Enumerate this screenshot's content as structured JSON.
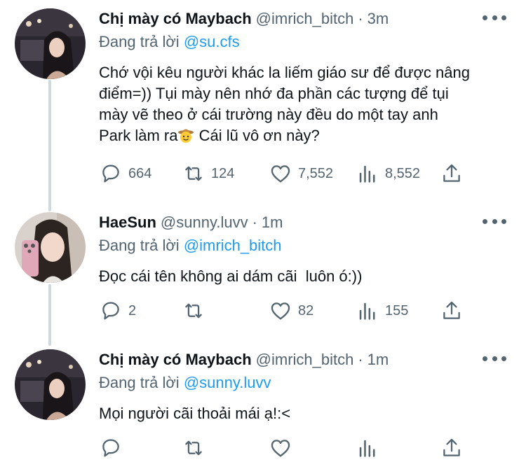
{
  "tweets": [
    {
      "name": "Chị mày có Maybach",
      "handle": "@imrich_bitch",
      "time": "3m",
      "reply_prefix": "Đang trả lời",
      "reply_to": "@su.cfs",
      "lines": [
        "Chớ vội kêu người khác la liếm giáo sư để được nâng",
        "điểm=)) Tụi mày nên nhớ đa phần các tượng để tụi",
        "mày vẽ theo ở cái trường này đều do một tay anh"
      ],
      "last_line_before_emoji": "Park làm ra",
      "emoji": "cowboy-face-emoji",
      "last_line_after_emoji": " Cái lũ vô ơn này?",
      "replies": "664",
      "retweets": "124",
      "likes": "7,552",
      "views": "8,552"
    },
    {
      "name": "HaeSun",
      "handle": "@sunny.luvv",
      "time": "1m",
      "reply_prefix": "Đang trả lời",
      "reply_to": "@imrich_bitch",
      "lines": [
        "Đọc cái tên không ai dám cãi  luôn ó:))"
      ],
      "replies": "2",
      "retweets": "",
      "likes": "82",
      "views": "155"
    },
    {
      "name": "Chị mày có Maybach",
      "handle": "@imrich_bitch",
      "time": "1m",
      "reply_prefix": "Đang trả lời",
      "reply_to": "@sunny.luvv",
      "lines": [
        "Mọi người cãi thoải mái ạ!:<"
      ],
      "replies": "",
      "retweets": "",
      "likes": "",
      "views": ""
    }
  ],
  "colors": {
    "accent": "#1d9bf0",
    "secondary": "#536471",
    "text": "#0f1419",
    "thread_line": "#cfd9de"
  }
}
